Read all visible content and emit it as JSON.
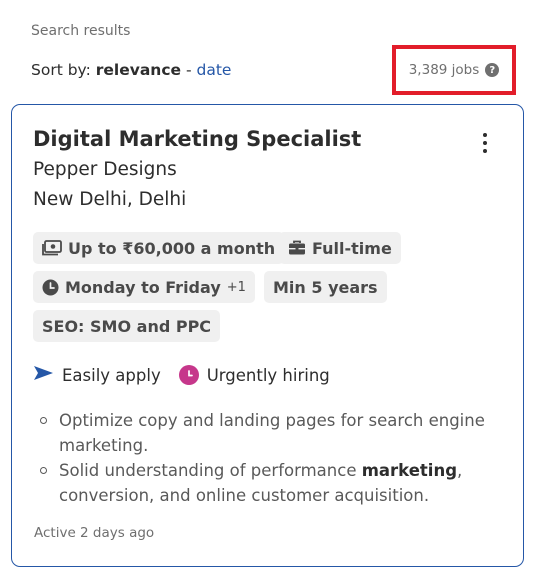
{
  "header": {
    "results_label": "Search results",
    "sort_prefix": "Sort by:",
    "sort_current": "relevance",
    "sort_separator": " - ",
    "sort_alternative": "date",
    "job_count": "3,389 jobs",
    "help_icon": "question-circle-icon",
    "highlight_color": "#e21d2a"
  },
  "job_card": {
    "title": "Digital Marketing Specialist",
    "company": "Pepper Designs",
    "location": "New Delhi, Delhi",
    "menu_icon": "kebab-menu-icon",
    "chips": {
      "salary": {
        "label": "Up to ₹60,000 a month",
        "icon": "money-icon"
      },
      "job_type": {
        "label": "Full-time",
        "icon": "briefcase-icon"
      },
      "schedule": {
        "label": "Monday to Friday",
        "extra": "+1",
        "icon": "clock-icon"
      },
      "experience": {
        "label": "Min 5 years"
      },
      "skill": {
        "label": "SEO: SMO and PPC"
      }
    },
    "badges": {
      "easy_apply": {
        "label": "Easily apply",
        "icon": "send-arrow-icon",
        "color": "#2557a7"
      },
      "urgent": {
        "label": "Urgently hiring",
        "icon": "clock-icon",
        "color": "#c6378b"
      }
    },
    "snippet": [
      {
        "text": "Optimize copy and landing pages for search engine marketing."
      },
      {
        "before": "Solid understanding of performance ",
        "bold": "marketing",
        "after": ", conversion, and online customer acquisition."
      }
    ],
    "posted": "Active 2 days ago",
    "border_color": "#2557a7"
  }
}
